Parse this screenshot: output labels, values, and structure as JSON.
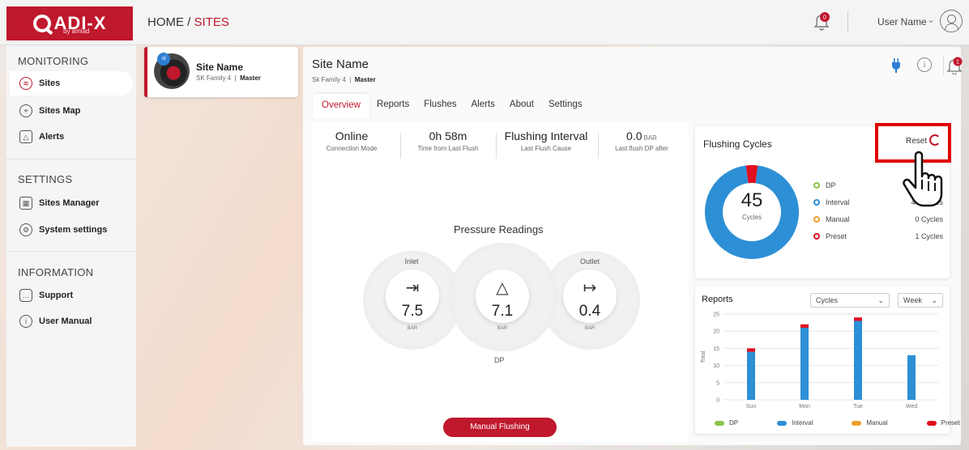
{
  "topbar": {
    "logo": "ADI-X",
    "logo_sub": "by amiad",
    "breadcrumb_home": "HOME / ",
    "breadcrumb_current": "SITES",
    "notification_count": "0",
    "user_name": "User Name"
  },
  "sidebar": {
    "monitoring_title": "MONITORING",
    "settings_title": "SETTINGS",
    "information_title": "INFORMATION",
    "items": [
      {
        "label": "Sites",
        "icon": "layers-icon"
      },
      {
        "label": "Sites Map",
        "icon": "map-pin-icon"
      },
      {
        "label": "Alerts",
        "icon": "bell-icon"
      },
      {
        "label": "Sites Manager",
        "icon": "sites-manager-icon"
      },
      {
        "label": "System settings",
        "icon": "gear-icon"
      },
      {
        "label": "Support",
        "icon": "chat-icon"
      },
      {
        "label": "User Manual",
        "icon": "info-icon"
      }
    ]
  },
  "site_card": {
    "name": "Site Name",
    "family": "SK Family 4",
    "role": "Master"
  },
  "panel": {
    "title": "Site Name",
    "family": "Sk Family 4",
    "role": "Master",
    "alert_count": "1",
    "tabs": [
      "Overview",
      "Reports",
      "Flushes",
      "Alerts",
      "About",
      "Settings"
    ]
  },
  "stats": [
    {
      "value": "Online",
      "unit": "",
      "label": "Connection Mode"
    },
    {
      "value": "0h 58m",
      "unit": "",
      "label": "Time from Last Flush"
    },
    {
      "value": "Flushing Interval",
      "unit": "",
      "label": "Last Flush Cause"
    },
    {
      "value": "0.0",
      "unit": "BAR",
      "label": "Last flush DP after"
    }
  ],
  "pressure": {
    "title": "Pressure Readings",
    "inlet_label": "Inlet",
    "inlet_value": "7.5",
    "dp_value": "7.1",
    "outlet_label": "Outlet",
    "outlet_value": "0.4",
    "unit": "BAR",
    "dp_label": "DP"
  },
  "manual_button": "Manual Flushing",
  "flushing": {
    "title": "Flushing Cycles",
    "reset_label": "Reset",
    "total": "45",
    "total_label": "Cycles",
    "legend": [
      {
        "name": "DP",
        "color": "#8bc34a",
        "value": ""
      },
      {
        "name": "Interval",
        "color": "#2d8fd5",
        "value": "44 Cycles"
      },
      {
        "name": "Manual",
        "color": "#f0a030",
        "value": "0 Cycles"
      },
      {
        "name": "Preset",
        "color": "#e01020",
        "value": "1 Cycles"
      }
    ]
  },
  "reports": {
    "title": "Reports",
    "metric_select": "Cycles",
    "period_select": "Week",
    "legend": [
      "DP",
      "Interval",
      "Manual",
      "Preset"
    ]
  },
  "chart_data": {
    "type": "bar",
    "categories": [
      "Sun",
      "Mon",
      "Tue",
      "Wed"
    ],
    "series": [
      {
        "name": "DP",
        "values": [
          0,
          0,
          0,
          0
        ],
        "color": "#8bc34a"
      },
      {
        "name": "Interval",
        "values": [
          14,
          21,
          23,
          13
        ],
        "color": "#2d8fd5"
      },
      {
        "name": "Manual",
        "values": [
          0,
          0,
          0,
          0
        ],
        "color": "#f0a030"
      },
      {
        "name": "Preset",
        "values": [
          1,
          1,
          1,
          0
        ],
        "color": "#e01020"
      }
    ],
    "ylabel": "Total",
    "yticks": [
      0,
      5,
      10,
      15,
      20,
      25
    ],
    "ylim": [
      0,
      25
    ],
    "grid": true,
    "stacked": true,
    "legend_position": "bottom"
  }
}
